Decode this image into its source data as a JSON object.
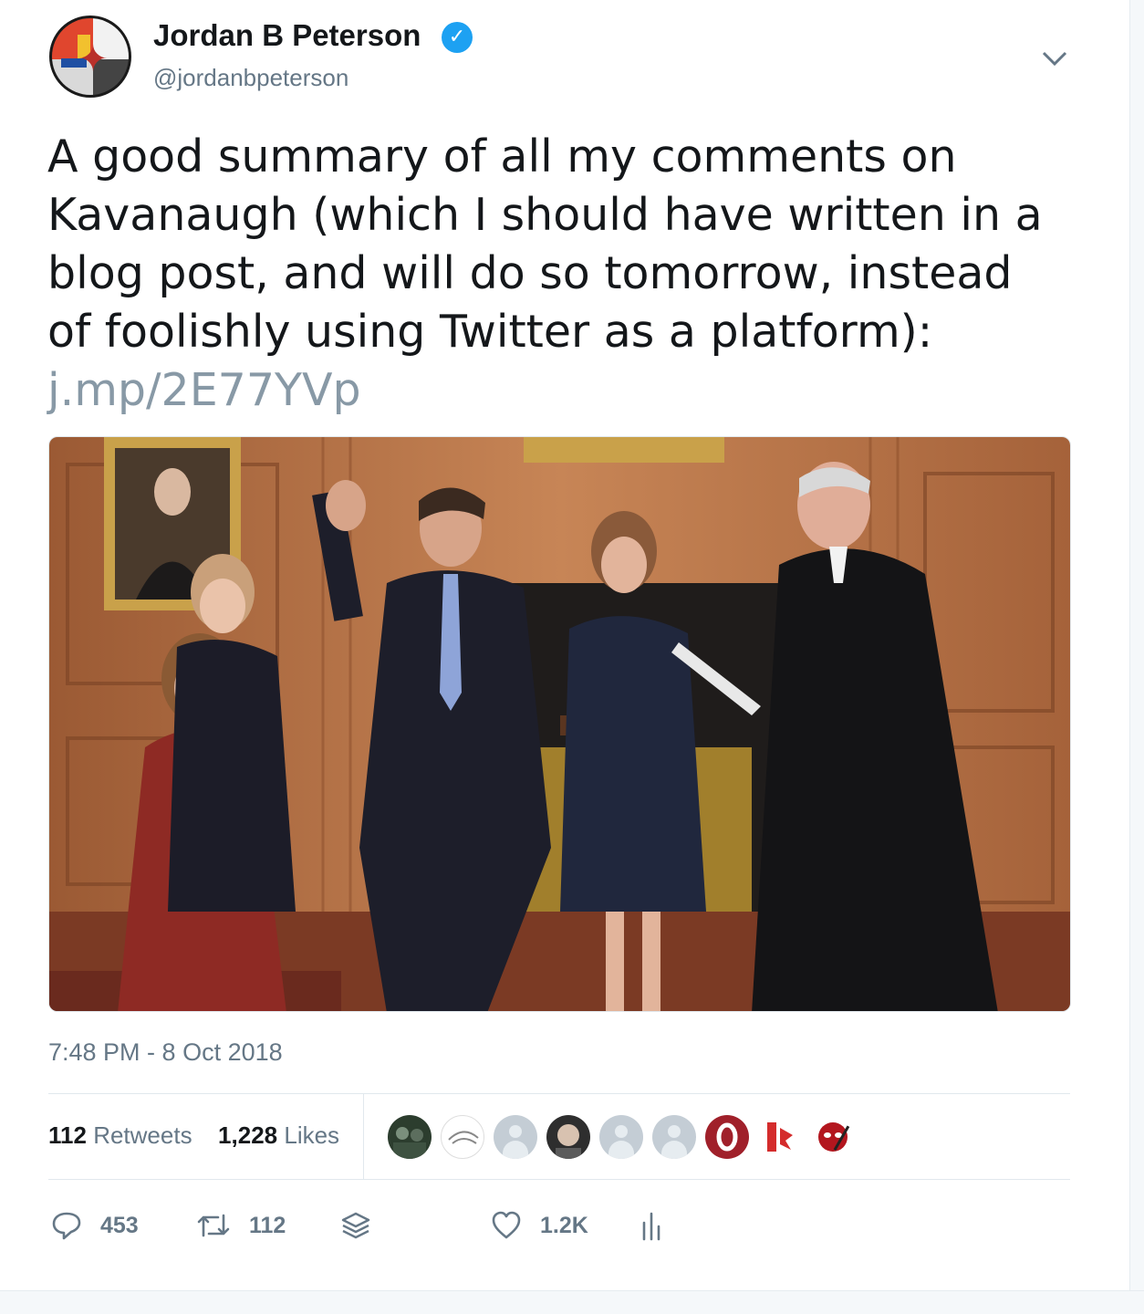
{
  "author": {
    "name": "Jordan B Peterson",
    "handle": "@jordanbpeterson",
    "verified": true
  },
  "tweet": {
    "text": "A good summary of all my comments on\nKavanaugh (which I should have written in a\nblog post, and will do so tomorrow, instead\nof foolishly using Twitter as a platform):\n",
    "link": "j.mp/2E77YVp",
    "timestamp": "7:48 PM - 8 Oct 2018"
  },
  "stats": {
    "retweets_count": "112",
    "retweets_label": "Retweets",
    "likes_count": "1,228",
    "likes_label": "Likes"
  },
  "actions": {
    "reply_count": "453",
    "retweet_count": "112",
    "like_count": "1.2K"
  },
  "icons": {
    "verified": "verified-badge-icon",
    "caret": "chevron-down-icon",
    "reply": "reply-icon",
    "retweet": "retweet-icon",
    "stack": "stack-icon",
    "like": "heart-icon",
    "analytics": "analytics-icon"
  },
  "colors": {
    "accent": "#1da1f2",
    "muted": "#657786",
    "link": "#8899a6"
  }
}
